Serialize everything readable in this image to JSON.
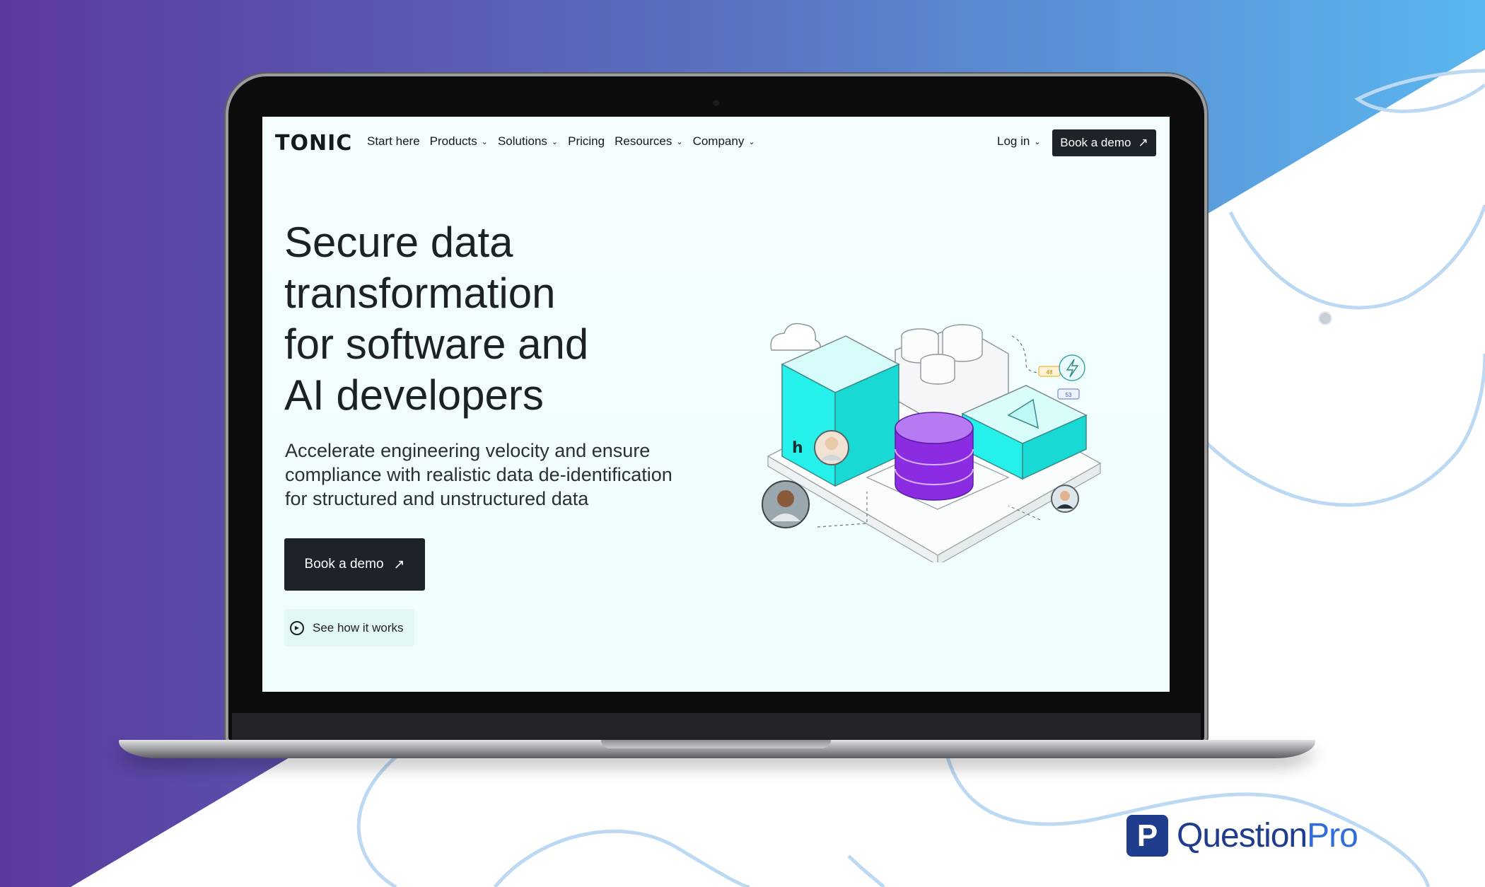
{
  "colors": {
    "bg_purple": "#5b3a9e",
    "bg_blue": "#5ab6ee",
    "accent_highlight": "#f7ff2f",
    "cta_dark": "#1d2328",
    "cyan": "#26f0ea",
    "purple": "#8b2be2",
    "brand_blue": "#1f3d8c"
  },
  "site": {
    "logo": "TONIC",
    "nav": {
      "items": [
        {
          "label": "Start here",
          "dropdown": false
        },
        {
          "label": "Products",
          "dropdown": true
        },
        {
          "label": "Solutions",
          "dropdown": true
        },
        {
          "label": "Pricing",
          "dropdown": false
        },
        {
          "label": "Resources",
          "dropdown": true
        },
        {
          "label": "Company",
          "dropdown": true
        }
      ],
      "login": "Log in",
      "cta": "Book a demo"
    },
    "hero": {
      "title_lines": [
        "Secure data",
        "transformation",
        "for software and",
        "AI developers"
      ],
      "subtitle_lines": [
        "Accelerate engineering velocity and ensure",
        "compliance with realistic data de-identification",
        "for structured and unstructured data"
      ],
      "cta": "Book a demo",
      "secondary": "See how it works"
    },
    "illustration": {
      "badge_a": "48",
      "badge_b": "53"
    }
  },
  "watermark": {
    "brand_part1": "Question",
    "brand_part2": "Pro"
  },
  "icons": [
    "arrow-up-right-icon",
    "chevron-down-icon",
    "play-circle-icon",
    "lightning-icon",
    "cloud-icon",
    "user-avatar-icon"
  ]
}
